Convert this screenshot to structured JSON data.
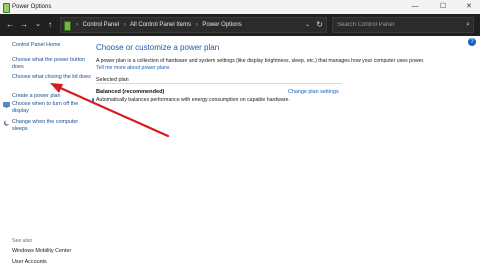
{
  "window": {
    "title": "Power Options",
    "minimize": "—",
    "maximize": "☐",
    "close": "✕"
  },
  "nav": {
    "back": "←",
    "forward": "→",
    "dropdown": "⌄",
    "up": "↑",
    "breadcrumb": [
      "Control Panel",
      "All Control Panel Items",
      "Power Options"
    ],
    "breadcrumb_sep": "›",
    "search_placeholder": "Search Control Panel"
  },
  "sidebar": {
    "home": "Control Panel Home",
    "links": [
      "Choose what the power button does",
      "Choose what closing the lid does",
      "Create a power plan",
      "Choose when to turn off the display",
      "Change when the computer sleeps"
    ],
    "see_also_heading": "See also",
    "see_also": [
      "Windows Mobility Center",
      "User Accounts"
    ]
  },
  "main": {
    "title": "Choose or customize a power plan",
    "description": "A power plan is a collection of hardware and system settings (like display brightness, sleep, etc.) that manages how your computer uses power.",
    "tell_more": "Tell me more about power plans",
    "selected_plan_label": "Selected plan",
    "plan_name": "Balanced (recommended)",
    "plan_description": "Automatically balances performance with energy consumption on capable hardware.",
    "change_plan_link": "Change plan settings"
  },
  "colors": {
    "annotation_arrow": "#d81b1b",
    "link": "#1a4f8a",
    "title": "#1e5aa8"
  }
}
